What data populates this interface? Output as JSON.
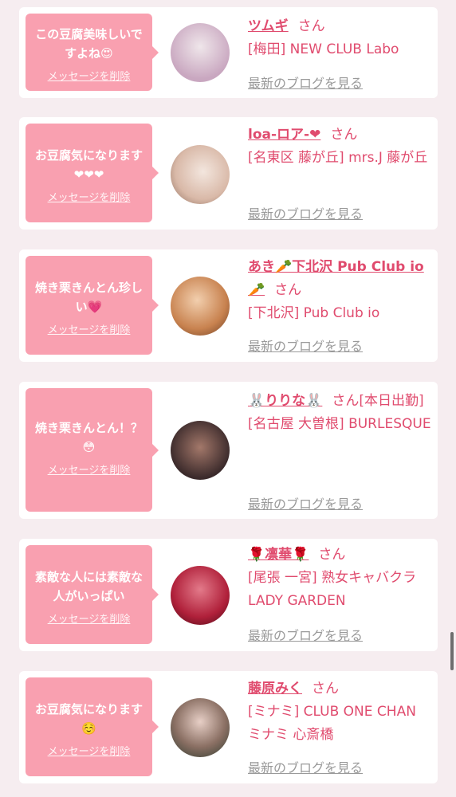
{
  "cards": [
    {
      "message": "この豆腐美味しいですよね😍",
      "delete_label": "メッセージを削除",
      "name": "ツムギ",
      "san": "さん",
      "shop": "[梅田] NEW CLUB Labo",
      "blog_label": "最新のブログを見る",
      "avatar_colors": [
        "#c9a7c0",
        "#efe6ea"
      ]
    },
    {
      "message": "お豆腐気になります❤❤❤",
      "delete_label": "メッセージを削除",
      "name": "loa-ロア-❤",
      "san": "さん",
      "shop": "[名東区 藤が丘] mrs.J 藤が丘",
      "blog_label": "最新のブログを見る",
      "avatar_colors": [
        "#d9b9a8",
        "#f3e6de"
      ]
    },
    {
      "message": "焼き栗きんとん珍しい💗",
      "delete_label": "メッセージを削除",
      "name": "あき🥕下北沢 Pub Club io🥕",
      "san": "さん",
      "shop": "[下北沢] Pub Club io",
      "blog_label": "最新のブログを見る",
      "avatar_colors": [
        "#c8824f",
        "#f2cfae"
      ]
    },
    {
      "message": "焼き栗きんとん！？😳",
      "delete_label": "メッセージを削除",
      "name": "🐰りりな🐰",
      "san": "さん[本日出勤]",
      "shop": "[名古屋 大曽根] BURLESQUE",
      "blog_label": "最新のブログを見る",
      "avatar_colors": [
        "#3b2a2b",
        "#a3786a"
      ]
    },
    {
      "message": "素敵な人には素敵な人がいっぱい",
      "delete_label": "メッセージを削除",
      "name": "🌹凛華🌹",
      "san": "さん",
      "shop": "[尾張 一宮] 熟女キャバクラ LADY GARDEN",
      "blog_label": "最新のブログを見る",
      "avatar_colors": [
        "#b0203a",
        "#e37a8a"
      ]
    },
    {
      "message": "お豆腐気になります☺️",
      "delete_label": "メッセージを削除",
      "name": "藤原みく",
      "san": "さん",
      "shop": "[ミナミ] CLUB ONE CHAN ミナミ 心斎橋",
      "blog_label": "最新のブログを見る",
      "avatar_colors": [
        "#2e3b2f",
        "#e7cfc6"
      ]
    }
  ]
}
